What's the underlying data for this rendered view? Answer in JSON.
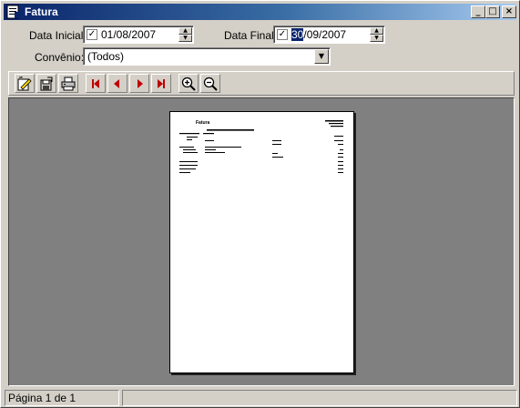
{
  "window": {
    "title": "Fatura",
    "icon": "report-app-icon",
    "buttons": {
      "minimize": "_",
      "maximize": "□",
      "close": "×"
    }
  },
  "filters": {
    "data_inicial": {
      "label": "Data Inicial:",
      "checked": true,
      "value": "01/08/2007"
    },
    "data_final": {
      "label": "Data Final:",
      "checked": true,
      "value_selected": "30",
      "value_rest": "/09/2007"
    },
    "convenio": {
      "label": "Convênio:",
      "value": "(Todos)"
    }
  },
  "toolbar": {
    "buttons": [
      {
        "name": "edit-report-button",
        "icon": "edit-icon"
      },
      {
        "name": "export-button",
        "icon": "export-icon"
      },
      {
        "name": "print-button",
        "icon": "printer-icon"
      },
      {
        "name": "first-page-button",
        "icon": "first-page-icon"
      },
      {
        "name": "previous-page-button",
        "icon": "previous-page-icon"
      },
      {
        "name": "next-page-button",
        "icon": "next-page-icon"
      },
      {
        "name": "last-page-button",
        "icon": "last-page-icon"
      },
      {
        "name": "zoom-in-button",
        "icon": "zoom-in-icon"
      },
      {
        "name": "zoom-out-button",
        "icon": "zoom-out-icon"
      }
    ]
  },
  "preview": {
    "page_title": "Fatura"
  },
  "status": {
    "page_info": "Página 1 de 1"
  },
  "colors": {
    "face": "#d4d0c8",
    "title_gradient_start": "#0a246a",
    "title_gradient_end": "#a6caf0",
    "preview_bg": "#808080",
    "nav_arrow": "#c00000"
  }
}
